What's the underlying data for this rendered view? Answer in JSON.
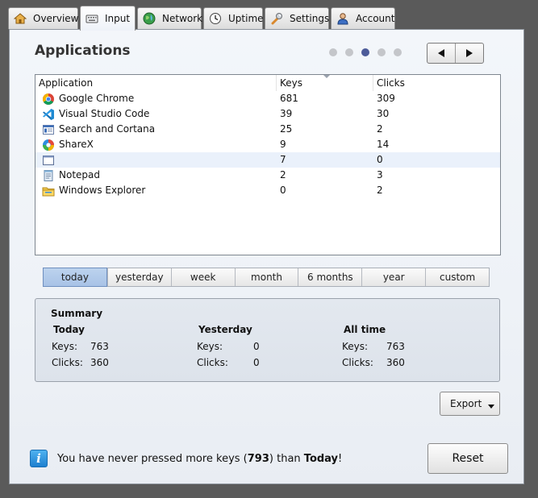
{
  "tabs": [
    {
      "label": "Overview",
      "icon": "home-icon"
    },
    {
      "label": "Input",
      "icon": "keyboard-icon"
    },
    {
      "label": "Network",
      "icon": "globe-icon"
    },
    {
      "label": "Uptime",
      "icon": "clock-icon"
    },
    {
      "label": "Settings",
      "icon": "wrench-icon"
    },
    {
      "label": "Account",
      "icon": "user-icon"
    }
  ],
  "active_tab": "Input",
  "page_title": "Applications",
  "pager": {
    "count": 5,
    "active_index": 2
  },
  "table": {
    "columns": [
      "Application",
      "Keys",
      "Clicks"
    ],
    "sorted_column": "Keys",
    "rows": [
      {
        "app": "Google Chrome",
        "keys": "681",
        "clicks": "309",
        "icon": "chrome-icon"
      },
      {
        "app": "Visual Studio Code",
        "keys": "39",
        "clicks": "30",
        "icon": "vscode-icon"
      },
      {
        "app": "Search and Cortana",
        "keys": "25",
        "clicks": "2",
        "icon": "window-app-icon"
      },
      {
        "app": "ShareX",
        "keys": "9",
        "clicks": "14",
        "icon": "sharex-icon"
      },
      {
        "app": "",
        "keys": "7",
        "clicks": "0",
        "icon": "blank-window-icon"
      },
      {
        "app": "Notepad",
        "keys": "2",
        "clicks": "3",
        "icon": "notepad-icon"
      },
      {
        "app": "Windows Explorer",
        "keys": "0",
        "clicks": "2",
        "icon": "folder-icon"
      }
    ],
    "selected_row_index": 4
  },
  "ranges": [
    "today",
    "yesterday",
    "week",
    "month",
    "6 months",
    "year",
    "custom"
  ],
  "active_range": "today",
  "summary": {
    "title": "Summary",
    "keys_label": "Keys:",
    "clicks_label": "Clicks:",
    "columns": [
      {
        "heading": "Today",
        "keys": "763",
        "clicks": "360"
      },
      {
        "heading": "Yesterday",
        "keys": "0",
        "clicks": "0"
      },
      {
        "heading": "All time",
        "keys": "763",
        "clicks": "360"
      }
    ]
  },
  "export_label": "Export",
  "footer": {
    "prefix": "You have never pressed more keys (",
    "value": "793",
    "middle": ") than ",
    "period": "Today",
    "suffix": "!"
  },
  "reset_label": "Reset",
  "colors": {
    "accent": "#4c5b99",
    "selected_range": "#b3cbeb",
    "selected_row": "#eaf1fb"
  }
}
